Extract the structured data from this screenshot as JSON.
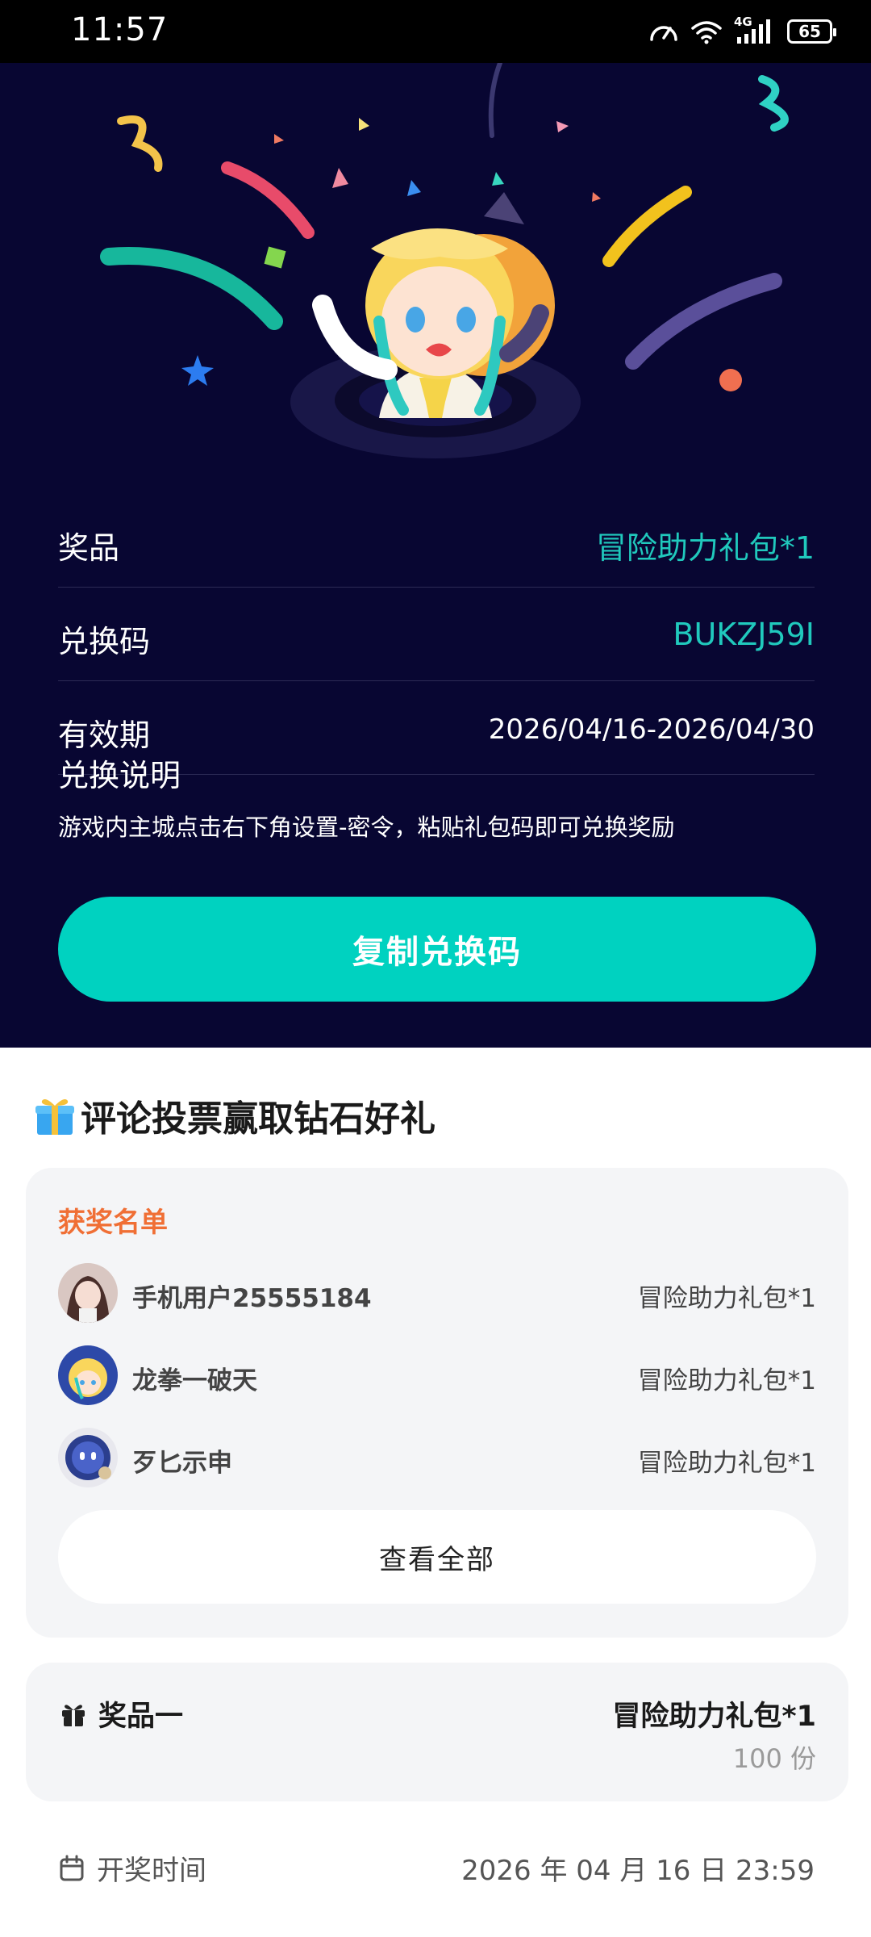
{
  "status_bar": {
    "time": "11:57",
    "network": "4G",
    "battery": "65",
    "icons": [
      "speedometer-icon",
      "wifi-icon",
      "signal-icon",
      "battery-icon"
    ]
  },
  "colors": {
    "hero_bg": "#080632",
    "accent": "#00d2c0",
    "accent_text": "#20c9bd",
    "winners_title": "#f06f35",
    "card_bg": "#f4f5f7"
  },
  "reward": {
    "prize_label": "奖品",
    "prize_value": "冒险助力礼包*1",
    "code_label": "兑换码",
    "code_value": "BUKZJ59I",
    "validity_label": "有效期",
    "validity_value": "2026/04/16-2026/04/30",
    "instructions_title": "兑换说明",
    "instructions_text": "游戏内主城点击右下角设置-密令，粘贴礼包码即可兑换奖励",
    "copy_button": "复制兑换码"
  },
  "campaign": {
    "title": "评论投票赢取钻石好礼",
    "winners_title": "获奖名单",
    "winners": [
      {
        "name": "手机用户25555184",
        "prize": "冒险助力礼包*1"
      },
      {
        "name": "龙拳一破天",
        "prize": "冒险助力礼包*1"
      },
      {
        "name": "歹匕示申",
        "prize": "冒险助力礼包*1"
      }
    ],
    "view_all": "查看全部",
    "prize_label": "奖品一",
    "prize_name": "冒险助力礼包*1",
    "prize_count": "100 份",
    "draw_time_label": "开奖时间",
    "draw_time_value": "2026 年 04 月 16 日 23:59"
  }
}
